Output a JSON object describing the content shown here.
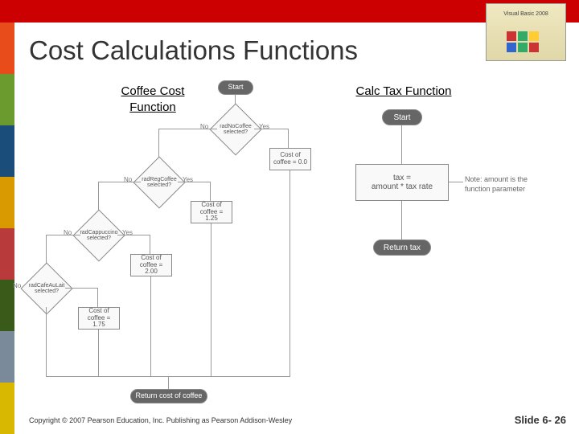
{
  "header": {
    "title": "Cost Calculations Functions",
    "brand": "Visual Basic 2008"
  },
  "left_flow": {
    "title": "Coffee Cost Function",
    "start": "Start",
    "d1": "radNoCoffee selected?",
    "d1_no": "No",
    "d1_yes": "Yes",
    "r1": "Cost of coffee = 0.0",
    "d2": "radRegCoffee selected?",
    "d2_no": "No",
    "d2_yes": "Yes",
    "r2": "Cost of coffee = 1.25",
    "d3": "radCappuccino selected?",
    "d3_no": "No",
    "d3_yes": "Yes",
    "r3": "Cost of coffee = 2.00",
    "d4": "radCafeAuLait selected?",
    "d4_no": "No",
    "r4": "Cost of coffee = 1.75",
    "end": "Return cost of coffee"
  },
  "right_flow": {
    "title": "Calc Tax Function",
    "start": "Start",
    "process": "tax =\namount * tax rate",
    "note": "Note: amount is the function parameter",
    "end": "Return tax"
  },
  "footer": {
    "copyright": "Copyright © 2007 Pearson Education, Inc. Publishing as Pearson Addison-Wesley",
    "slide": "Slide 6- 26"
  }
}
